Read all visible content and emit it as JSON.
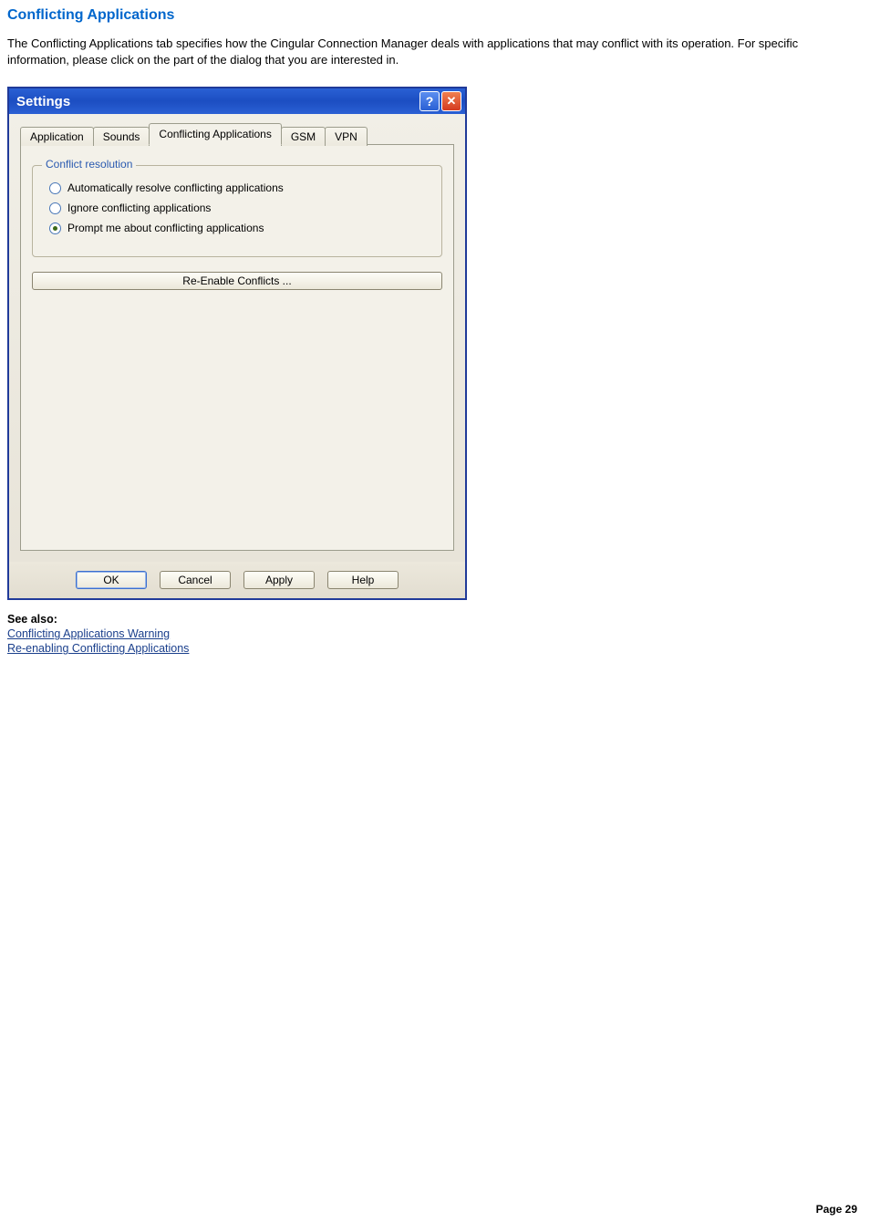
{
  "page": {
    "title": "Conflicting Applications",
    "intro": "The Conflicting Applications tab specifies how the Cingular Connection Manager deals with applications that may conflict with its operation. For specific information, please click on the part of the dialog that you are interested in.",
    "see_also_heading": "See also:",
    "see_also_links": [
      "Conflicting Applications Warning",
      "Re-enabling Conflicting Applications"
    ],
    "footer": "Page 29"
  },
  "dialog": {
    "title": "Settings",
    "help_symbol": "?",
    "close_symbol": "✕",
    "tabs": {
      "application": "Application",
      "sounds": "Sounds",
      "conflicting": "Conflicting Applications",
      "gsm": "GSM",
      "vpn": "VPN"
    },
    "groupbox_legend": "Conflict resolution",
    "radios": {
      "auto": "Automatically resolve conflicting applications",
      "ignore": "Ignore conflicting applications",
      "prompt": "Prompt me about conflicting applications"
    },
    "re_enable_button": "Re-Enable Conflicts ...",
    "buttons": {
      "ok": "OK",
      "cancel": "Cancel",
      "apply": "Apply",
      "help": "Help"
    }
  }
}
